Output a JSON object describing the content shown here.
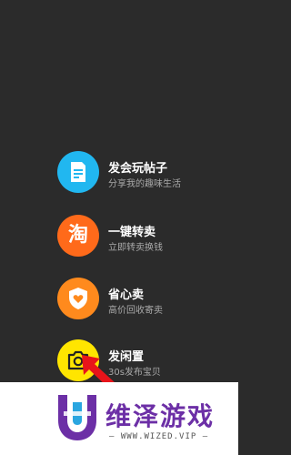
{
  "menu": {
    "items": [
      {
        "title": "发会玩帖子",
        "subtitle": "分享我的趣味生活",
        "color": "#21b7f0",
        "icon": "document-icon"
      },
      {
        "title": "一键转卖",
        "subtitle": "立即转卖换钱",
        "color": "#ff6a1a",
        "icon": "taobao-icon",
        "icon_text": "淘"
      },
      {
        "title": "省心卖",
        "subtitle": "高价回收寄卖",
        "color": "#ff8a1d",
        "icon": "shield-heart-icon"
      },
      {
        "title": "发闲置",
        "subtitle": "30s发布宝贝",
        "color": "#ffe500",
        "icon": "camera-icon"
      }
    ]
  },
  "overlay": {
    "arrow_color": "#e8141a",
    "watermark": {
      "title": "维泽游戏",
      "url": "— WWW.WIZED.VIP —",
      "brand_colors": [
        "#6c2fa6",
        "#2aa6e0"
      ]
    }
  }
}
